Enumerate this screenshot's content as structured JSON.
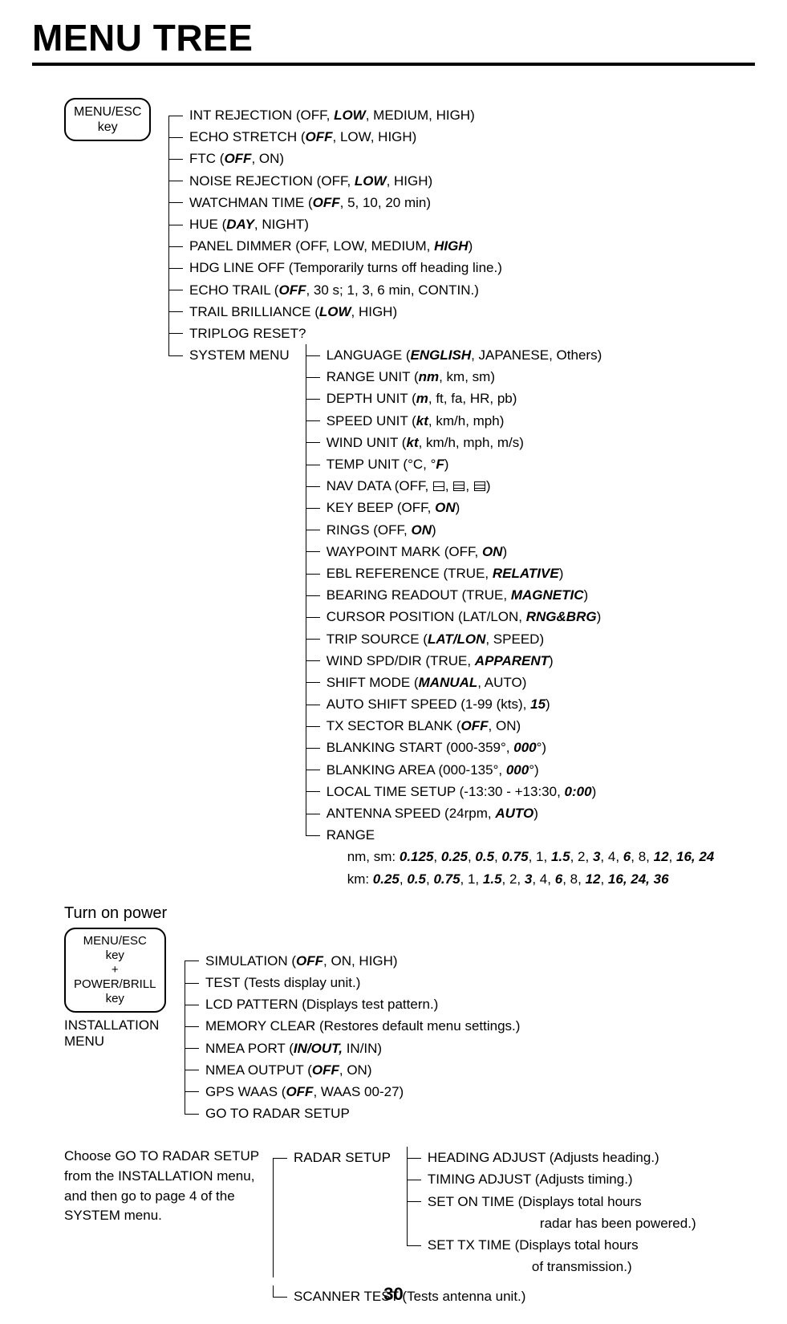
{
  "page_number": "30",
  "title": "MENU TREE",
  "key1": {
    "l1": "MENU/ESC",
    "l2": "key"
  },
  "key2": {
    "l1": "MENU/ESC",
    "l2": "key",
    "l3": "+",
    "l4": "POWER/BRILL",
    "l5": "key"
  },
  "turn_on": "Turn on power",
  "install_label_l1": "INSTALLATION",
  "install_label_l2": "MENU",
  "note_l1": "Choose GO TO RADAR SETUP",
  "note_l2": "from the INSTALLATION menu,",
  "note_l3": "and then go to page 4 of the",
  "note_l4": "SYSTEM menu.",
  "m": {
    "i0": "INT REJECTION (OFF, ",
    "i0b": "LOW",
    "i0c": ", MEDIUM, HIGH)",
    "i1": "ECHO STRETCH (",
    "i1b": "OFF",
    "i1c": ", LOW, HIGH)",
    "i2": "FTC (",
    "i2b": "OFF",
    "i2c": ", ON)",
    "i3": "NOISE REJECTION (OFF, ",
    "i3b": "LOW",
    "i3c": ", HIGH)",
    "i4": "WATCHMAN TIME (",
    "i4b": "OFF",
    "i4c": ", 5, 10, 20 min)",
    "i5": "HUE (",
    "i5b": "DAY",
    "i5c": ", NIGHT)",
    "i6": "PANEL DIMMER  (OFF, LOW, MEDIUM, ",
    "i6b": "HIGH",
    "i6c": ")",
    "i7": "HDG LINE OFF (Temporarily turns off heading line.)",
    "i8": "ECHO TRAIL (",
    "i8b": "OFF",
    "i8c": ", 30 s; 1, 3, 6 min, CONTIN.)",
    "i9": "TRAIL BRILLIANCE (",
    "i9b": "LOW",
    "i9c": ", HIGH)",
    "i10": "TRIPLOG RESET?",
    "i11": "SYSTEM MENU"
  },
  "s": {
    "i0": "LANGUAGE (",
    "i0b": "ENGLISH",
    "i0c": ", JAPANESE, Others)",
    "i1": "RANGE UNIT (",
    "i1b": "nm",
    "i1c": ", km, sm)",
    "i2": "DEPTH UNIT (",
    "i2b": "m",
    "i2c": ", ft, fa, HR, pb)",
    "i3": "SPEED UNIT (",
    "i3b": "kt",
    "i3c": ", km/h, mph)",
    "i4": "WIND UNIT (",
    "i4b": "kt",
    "i4c": ", km/h, mph, m/s)",
    "i5a": "TEMP UNIT (°C, °",
    "i5b": "F",
    "i5c": ")",
    "i6": "NAV DATA (OFF, ",
    "i6c": ")",
    "i7": "KEY BEEP (OFF, ",
    "i7b": "ON",
    "i7c": ")",
    "i8": "RINGS (OFF, ",
    "i8b": "ON",
    "i8c": ")",
    "i9": "WAYPOINT MARK (OFF, ",
    "i9b": "ON",
    "i9c": ")",
    "i10": "EBL REFERENCE (TRUE, ",
    "i10b": "RELATIVE",
    "i10c": ")",
    "i11": "BEARING READOUT (TRUE, ",
    "i11b": "MAGNETIC",
    "i11c": ")",
    "i12": "CURSOR POSITION (LAT/LON, ",
    "i12b": "RNG&BRG",
    "i12c": ")",
    "i13": "TRIP SOURCE (",
    "i13b": "LAT/LON",
    "i13c": ", SPEED)",
    "i14": "WIND SPD/DIR (TRUE, ",
    "i14b": "APPARENT",
    "i14c": ")",
    "i15": "SHIFT MODE (",
    "i15b": "MANUAL",
    "i15c": ", AUTO)",
    "i16": "AUTO SHIFT SPEED (1-99 (kts), ",
    "i16b": "15",
    "i16c": ")",
    "i17": "TX SECTOR BLANK (",
    "i17b": "OFF",
    "i17c": ", ON)",
    "i18": "BLANKING START (000-359°, ",
    "i18b": "000",
    "i18c": "°)",
    "i19": "BLANKING AREA (000-135°, ",
    "i19b": "000",
    "i19c": "°)",
    "i20": "LOCAL TIME SETUP (-13:30 - +13:30, ",
    "i20b": "0:00",
    "i20c": ")",
    "i21": "ANTENNA SPEED (24rpm, ",
    "i21b": "AUTO",
    "i21c": ")",
    "i22": "RANGE",
    "r1a": "nm, sm: ",
    "r1b": "0.125",
    "r1c": ", ",
    "r1d": "0.25",
    "r1e": ", ",
    "r1f": "0.5",
    "r1g": ", ",
    "r1h": "0.75",
    "r1i": ", 1, ",
    "r1j": "1.5",
    "r1k": ", 2, ",
    "r1l": "3",
    "r1m": ", 4, ",
    "r1n": "6",
    "r1o": ", 8, ",
    "r1p": "12",
    "r1q": ", ",
    "r1r": "16, 24",
    "r2a": "km: ",
    "r2b": "0.25",
    "r2c": ", ",
    "r2d": "0.5",
    "r2e": ", ",
    "r2f": "0.75",
    "r2g": ", 1, ",
    "r2h": "1.5",
    "r2i": ", 2, ",
    "r2j": "3",
    "r2k": ", 4, ",
    "r2l": "6",
    "r2m": ", 8, ",
    "r2n": "12",
    "r2o": ", ",
    "r2p": "16, 24, 36"
  },
  "inst": {
    "i0": "SIMULATION (",
    "i0b": "OFF",
    "i0c": ", ON, HIGH)",
    "i1": "TEST (Tests display unit.)",
    "i2": "LCD PATTERN (Displays test pattern.)",
    "i3": "MEMORY CLEAR (Restores default menu settings.)",
    "i4": "NMEA PORT (",
    "i4b": "IN/OUT,",
    "i4c": " IN/IN)",
    "i5": "NMEA OUTPUT (",
    "i5b": "OFF",
    "i5c": ", ON)",
    "i6": "GPS WAAS (",
    "i6b": "OFF",
    "i6c": ", WAAS 00-27)",
    "i7": "GO TO RADAR SETUP"
  },
  "radar_setup_label": "RADAR SETUP",
  "rs": {
    "i0": "HEADING ADJUST (Adjusts heading.)",
    "i1": "TIMING ADJUST (Adjusts timing.)",
    "i2": "SET ON TIME (Displays total hours",
    "i2b": "radar has been powered.)",
    "i3": "SET TX TIME (Displays total hours",
    "i3b": "of transmission.)"
  },
  "scanner": "SCANNER TEST (Tests antenna unit.)"
}
